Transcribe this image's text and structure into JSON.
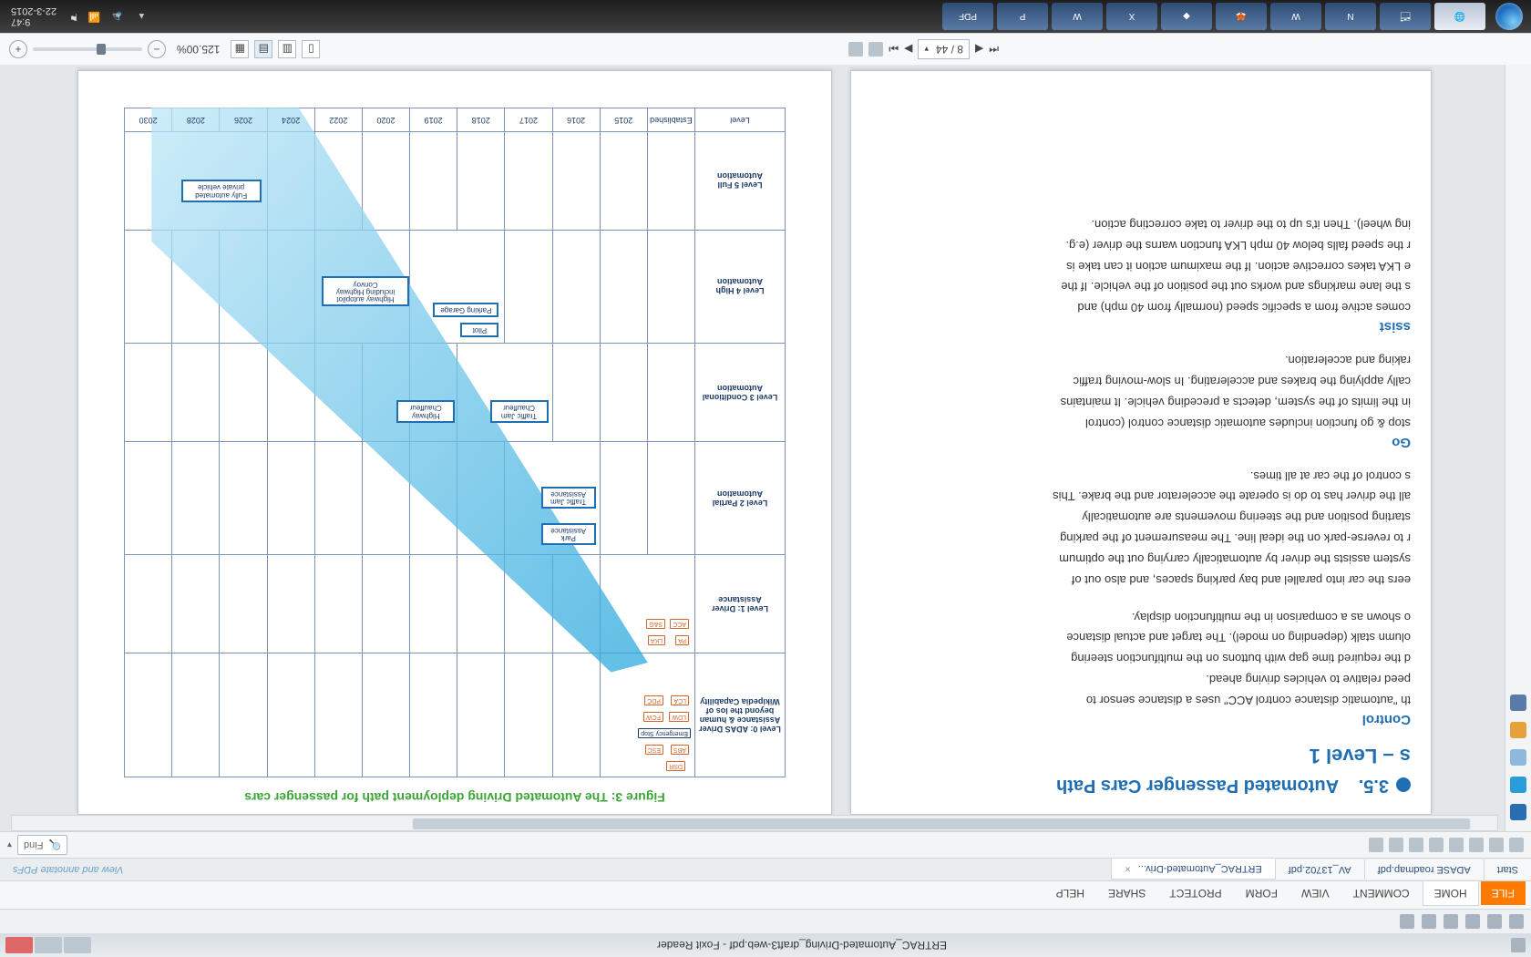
{
  "app": {
    "title_text": "ERTRAC_Automated-Driving_draft3-web.pdf - Foxit Reader",
    "tagline": "View and annotate PDFs"
  },
  "ribbon": {
    "file": "FILE",
    "tabs": [
      "HOME",
      "COMMENT",
      "VIEW",
      "FORM",
      "PROTECT",
      "SHARE",
      "HELP"
    ]
  },
  "doc_tabs": {
    "items": [
      "Start",
      "ADASE roadmap.pdf",
      "AV_13702.pdf",
      "ERTRAC_Automated-Driv..."
    ]
  },
  "find": {
    "placeholder": "Find"
  },
  "nav": {
    "page": "8 / 44"
  },
  "zoom": {
    "label": "125.00%"
  },
  "left_page": {
    "heading_prefix": "3.5.",
    "heading": "Automated Passenger Cars Path",
    "subheading": "s – Level 1",
    "sec_acc": "Control",
    "acc_p1": "th \"automatic distance control ACC\" uses a distance sensor to",
    "acc_p2": "peed relative to vehicles driving ahead.",
    "acc_p3": "d the required time gap with buttons on the multifunction steering",
    "acc_p4": "olumn stalk (depending on model). The target and actual distance",
    "acc_p5": "o shown as a comparison in the multifunction display.",
    "sec_park": "",
    "park_p1": "eers the car into parallel and bay parking spaces, and also out of",
    "park_p2": "system assists the driver by automatically carrying out the optimum",
    "park_p3": "r to reverse-park on the ideal line. The measurement of the parking",
    "park_p4": "starting position and the steering movements are automatically",
    "park_p5": "all the driver has to do is operate the accelerator and the brake. This",
    "park_p6": "s control of the car at all times.",
    "sec_sg": "Go",
    "sg_p1": " stop & go function includes automatic distance control (control",
    "sg_p2": "in the limits of the system, detects a preceding vehicle. It maintains",
    "sg_p3": "cally applying the brakes and accelerating. In slow-moving traffic",
    "sg_p4": "raking and acceleration.",
    "sec_lka": "ssist",
    "lka_p1": "comes active from a specific speed (normally from 40 mph) and",
    "lka_p2": "s the lane markings and works out the position of the vehicle. If the",
    "lka_p3": "e LKA takes corrective action. If the maximum action it can take is",
    "lka_p4": "r the speed falls below 40 mph LKA function warns the driver (e.g.",
    "lka_p5": "ing wheel). Then it's up to the driver to take correcting action."
  },
  "right_page": {
    "caption": "Figure 3: The Automated Driving deployment path for passenger cars"
  },
  "chart_data": {
    "type": "table",
    "title": "Automated Driving deployment path for passenger cars",
    "columns": [
      "Level",
      "Established",
      "2015",
      "2016",
      "2017",
      "2018",
      "2019",
      "2020",
      "2022",
      "2024",
      "2026",
      "2028",
      "2030"
    ],
    "level_labels": [
      "Level 0:\nADAS\nDriver Assistance\n&\nhuman beyond the\nlos of Wikipedia\nCapability",
      "Level 1:\nDriver Assistance",
      "Level 2\nPartial Automation",
      "Level 3\nConditional\nAutomation",
      "Level 4\nHigh Automation",
      "Level 5 Full Automation"
    ],
    "level0_chips": [
      "DSR",
      "ABS",
      "ESC",
      "Emergency Stop",
      "LDW",
      "FCW",
      "LCA",
      "PDC"
    ],
    "level1_chips": [
      "PA",
      "LKA",
      "ACC",
      "S&G"
    ],
    "level2_chips": [
      "Park\nAssistance",
      "Traffic Jam\nAssistance"
    ],
    "level3_chips": [
      "Traffic Jam\nChauffeur",
      "Highway\nChauffeur"
    ],
    "level4_chips": [
      "Pilot",
      "Parking Garage",
      "Highway autopilot\nincluding Highway\nConvoy"
    ],
    "level5_chips": [
      "Fully automated\nprivate vehicle"
    ]
  },
  "taskbar": {
    "clock": {
      "time": "9:47",
      "date": "22-3-2015"
    },
    "app_labels": [
      "",
      "",
      "",
      "",
      "",
      "",
      "",
      "",
      "",
      ""
    ]
  }
}
